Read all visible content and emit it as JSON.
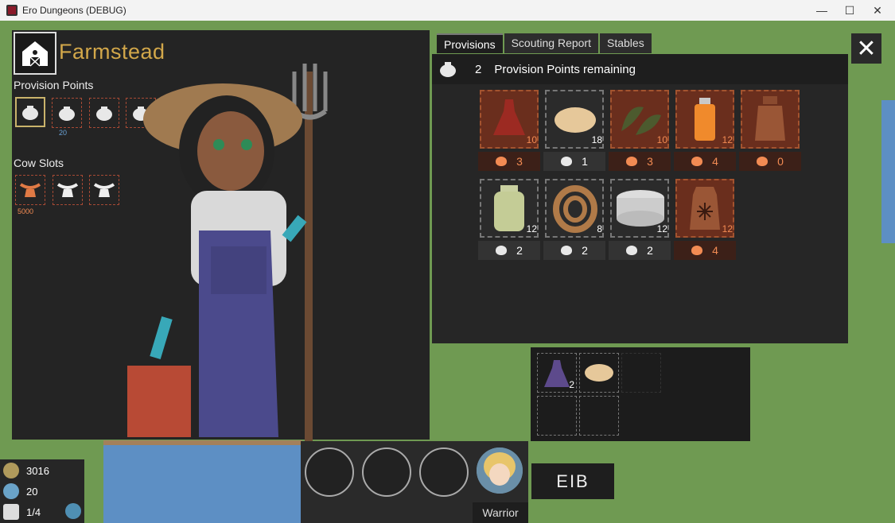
{
  "window": {
    "title": "Ero Dungeons (DEBUG)",
    "min": "—",
    "max": "☐",
    "close": "✕"
  },
  "location": {
    "title": "Farmstead"
  },
  "provision_points_label": "Provision Points",
  "provision_slots": [
    {
      "cost": ""
    },
    {
      "cost": "20"
    },
    {
      "cost": ""
    },
    {
      "cost": ""
    },
    {
      "cost": ""
    }
  ],
  "cow_slots_label": "Cow Slots",
  "cow_slots": [
    {
      "cost": "5000"
    },
    {
      "cost": ""
    },
    {
      "cost": ""
    }
  ],
  "tabs": [
    {
      "label": "Provisions"
    },
    {
      "label": "Scouting Report"
    },
    {
      "label": "Stables"
    }
  ],
  "close_label": "✕",
  "provisions": {
    "points": "2",
    "remaining_text": "Provision Points remaining",
    "items": [
      {
        "name": "red-potion-icon",
        "qty": "10",
        "cost": "3",
        "style": "red"
      },
      {
        "name": "bread-icon",
        "qty": "18",
        "cost": "1",
        "style": "grey"
      },
      {
        "name": "herbs-icon",
        "qty": "10",
        "cost": "3",
        "style": "red"
      },
      {
        "name": "orange-tonic-icon",
        "qty": "12",
        "cost": "4",
        "style": "red"
      },
      {
        "name": "milk-can-icon",
        "qty": "",
        "cost": "0",
        "style": "red"
      },
      {
        "name": "jar-icon",
        "qty": "12",
        "cost": "2",
        "style": "grey"
      },
      {
        "name": "rope-icon",
        "qty": "8",
        "cost": "2",
        "style": "grey"
      },
      {
        "name": "bandage-icon",
        "qty": "12",
        "cost": "2",
        "style": "grey"
      },
      {
        "name": "frost-sack-icon",
        "qty": "12",
        "cost": "4",
        "style": "red"
      }
    ]
  },
  "inventory": [
    {
      "name": "purple-potion-icon",
      "qty": "2"
    },
    {
      "name": "bread-icon",
      "qty": ""
    }
  ],
  "hud": {
    "gold": "3016",
    "favor": "20",
    "party": "1/4",
    "hero_class": "Warrior",
    "sign": "EIB"
  }
}
